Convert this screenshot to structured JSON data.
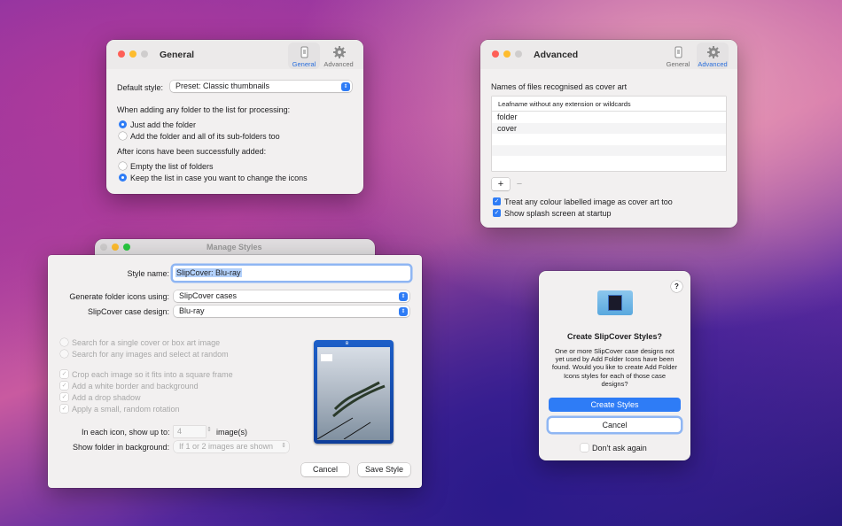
{
  "general_window": {
    "title": "General",
    "tabs": [
      {
        "label": "General"
      },
      {
        "label": "Advanced"
      }
    ],
    "default_style_label": "Default style:",
    "default_style_value": "Preset: Classic thumbnails",
    "adding_heading": "When adding any folder to the list for processing:",
    "adding_options": [
      "Just add the folder",
      "Add the folder and all of its sub-folders too"
    ],
    "after_heading": "After icons have been successfully added:",
    "after_options": [
      "Empty the list of folders",
      "Keep the list in case you want to change the icons"
    ]
  },
  "advanced_window": {
    "title": "Advanced",
    "tabs": [
      {
        "label": "General"
      },
      {
        "label": "Advanced"
      }
    ],
    "heading": "Names of files recognised as cover art",
    "table_header": "Leafname without any extension or wildcards",
    "rows": [
      "folder",
      "cover"
    ],
    "add_label": "+",
    "remove_label": "−",
    "checks": [
      "Treat any colour labelled image as cover art too",
      "Show splash screen at startup"
    ]
  },
  "manage_window": {
    "title": "Manage Styles"
  },
  "style_sheet": {
    "style_name_label": "Style name:",
    "style_name_value": "SlipCover: Blu-ray",
    "generate_label": "Generate folder icons using:",
    "generate_value": "SlipCover cases",
    "case_design_label": "SlipCover case design:",
    "case_design_value": "Blu-ray",
    "search_options": [
      "Search for a single cover or box art image",
      "Search for any images and select at random"
    ],
    "image_options": [
      "Crop each image so it fits into a square frame",
      "Add a white border and background",
      "Add a drop shadow",
      "Apply a small, random rotation"
    ],
    "show_up_to_label": "In each icon, show up to:",
    "show_up_to_value": "4",
    "images_unit": "image(s)",
    "background_label": "Show folder in background:",
    "background_value": "If 1 or 2 images are shown",
    "cancel": "Cancel",
    "save": "Save Style"
  },
  "dialog": {
    "help": "?",
    "title": "Create SlipCover Styles?",
    "message": "One or more SlipCover case designs not yet used by Add Folder Icons have been found. Would you like to create Add Folder Icons styles for each of those case designs?",
    "create": "Create Styles",
    "cancel": "Cancel",
    "dont_ask": "Don't ask again"
  },
  "colors": {
    "accent": "#2e7cf6",
    "red": "#fe5f57",
    "yellow": "#febc2e",
    "green": "#28c840"
  }
}
